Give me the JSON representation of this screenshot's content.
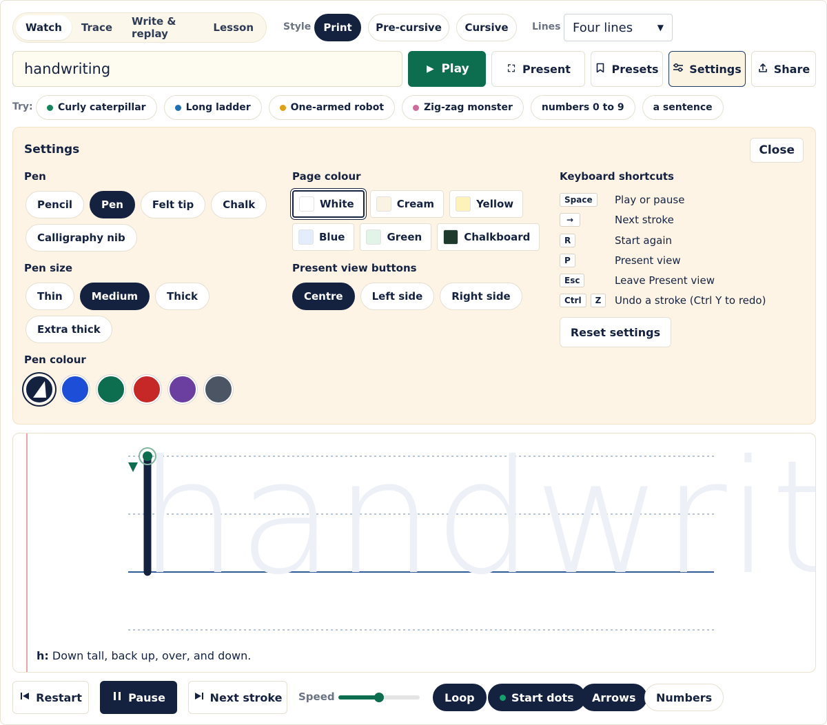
{
  "modes": [
    "Watch",
    "Trace",
    "Write & replay",
    "Lesson"
  ],
  "active_mode": "Watch",
  "style": {
    "label": "Style",
    "options": [
      "Print",
      "Pre-cursive",
      "Cursive"
    ],
    "active": "Print"
  },
  "lines": {
    "label": "Lines",
    "value": "Four lines"
  },
  "word_input": {
    "value": "handwriting"
  },
  "actions": {
    "play": "Play",
    "present": "Present",
    "presets": "Presets",
    "settings": "Settings",
    "share": "Share"
  },
  "try": {
    "label": "Try:",
    "chips": [
      {
        "label": "Curly caterpillar",
        "dot": "#12855c"
      },
      {
        "label": "Long ladder",
        "dot": "#1f6fb5"
      },
      {
        "label": "One-armed robot",
        "dot": "#e0a010"
      },
      {
        "label": "Zig-zag monster",
        "dot": "#d36a9c"
      },
      {
        "label": "numbers 0 to 9",
        "dot": ""
      },
      {
        "label": "a sentence",
        "dot": ""
      }
    ]
  },
  "settings": {
    "title": "Settings",
    "close": "Close",
    "pen": {
      "title": "Pen",
      "options": [
        "Pencil",
        "Pen",
        "Felt tip",
        "Chalk",
        "Calligraphy nib"
      ],
      "selected": "Pen"
    },
    "pen_size": {
      "title": "Pen size",
      "options": [
        "Thin",
        "Medium",
        "Thick",
        "Extra thick"
      ],
      "selected": "Medium"
    },
    "pen_colour": {
      "title": "Pen colour",
      "colors": [
        "#142240",
        "#1d4ed8",
        "#0d6e4f",
        "#c62828",
        "#6b3fa0",
        "#4b5563"
      ],
      "selected_index": 0
    },
    "page_colour": {
      "title": "Page colour",
      "options": [
        {
          "label": "White",
          "swatch": "#ffffff"
        },
        {
          "label": "Cream",
          "swatch": "#fbf3e2"
        },
        {
          "label": "Yellow",
          "swatch": "#fdf2b8"
        },
        {
          "label": "Blue",
          "swatch": "#e3edfb"
        },
        {
          "label": "Green",
          "swatch": "#e2f3e8"
        },
        {
          "label": "Chalkboard",
          "swatch": "#1e3a2c"
        }
      ],
      "selected": "White"
    },
    "present_view": {
      "title": "Present view buttons",
      "options": [
        "Centre",
        "Left side",
        "Right side"
      ],
      "selected": "Centre"
    },
    "shortcuts": {
      "title": "Keyboard shortcuts",
      "items": [
        {
          "keys": [
            "Space"
          ],
          "desc": "Play or pause"
        },
        {
          "keys": [
            "→"
          ],
          "desc": "Next stroke"
        },
        {
          "keys": [
            "R"
          ],
          "desc": "Start again"
        },
        {
          "keys": [
            "P"
          ],
          "desc": "Present view"
        },
        {
          "keys": [
            "Esc"
          ],
          "desc": "Leave Present view"
        },
        {
          "keys": [
            "Ctrl",
            "Z"
          ],
          "desc": "Undo a stroke (Ctrl Y to redo)"
        }
      ]
    },
    "reset": "Reset settings"
  },
  "canvas": {
    "guide_word": "handwriting",
    "hint_letter": "h:",
    "hint_text": " Down tall, back up, over, and down."
  },
  "controls": {
    "restart": "Restart",
    "pause": "Pause",
    "next_stroke": "Next stroke",
    "speed_label": "Speed",
    "speed_value": 0.5,
    "loop": "Loop",
    "start_dots": "Start dots",
    "arrows": "Arrows",
    "numbers": "Numbers"
  },
  "colors": {
    "navy": "#142240",
    "green": "#0d6e4f",
    "panel": "#fdf4e5"
  }
}
